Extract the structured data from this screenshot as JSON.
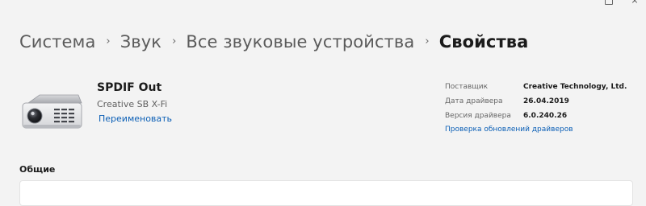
{
  "window_controls": {
    "maximize_icon": "maximize-icon",
    "close_glyph": "×"
  },
  "breadcrumb": {
    "items": [
      {
        "label": "Система"
      },
      {
        "label": "Звук"
      },
      {
        "label": "Все звуковые устройства"
      },
      {
        "label": "Свойства"
      }
    ],
    "separator": "›"
  },
  "device": {
    "name": "SPDIF Out",
    "subtitle": "Creative SB X-Fi",
    "rename_label": "Переименовать",
    "icon": "speaker-device-icon"
  },
  "driver_info": {
    "rows": [
      {
        "label": "Поставщик",
        "value": "Creative Technology, Ltd."
      },
      {
        "label": "Дата драйвера",
        "value": "26.04.2019"
      },
      {
        "label": "Версия драйвера",
        "value": "6.0.240.26"
      }
    ],
    "update_link": "Проверка обновлений драйверов"
  },
  "section": {
    "title": "Общие"
  },
  "colors": {
    "background": "#f3f3f3",
    "link": "#0b5fb6",
    "text": "#1b1b1b",
    "muted_text": "#606060"
  }
}
